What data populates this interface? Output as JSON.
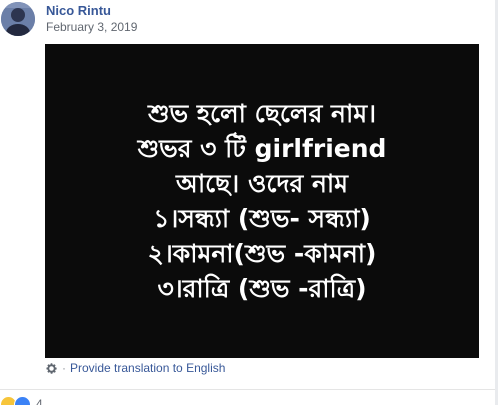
{
  "post": {
    "author": "Nico Rintu",
    "timestamp": "February 3, 2019",
    "image_text_lines": [
      "শুভ হলো ছেলের নাম।",
      "শুভর ৩ টি girlfriend",
      "আছে। ওদের নাম",
      "১।সন্ধ্যা (শুভ- সন্ধ্যা)",
      "২।কামনা(শুভ -কামনা)",
      "৩।রাত্রি (শুভ -রাত্রি)"
    ],
    "translate_link": "Provide translation to English",
    "separator": "·",
    "reaction_count": "4"
  },
  "icons": {
    "gear": "gear-icon",
    "haha": "haha-reaction-icon",
    "like": "like-reaction-icon"
  },
  "colors": {
    "link": "#385898",
    "meta": "#616770",
    "image_bg": "#0b0b0b",
    "image_text": "#ffffff"
  }
}
